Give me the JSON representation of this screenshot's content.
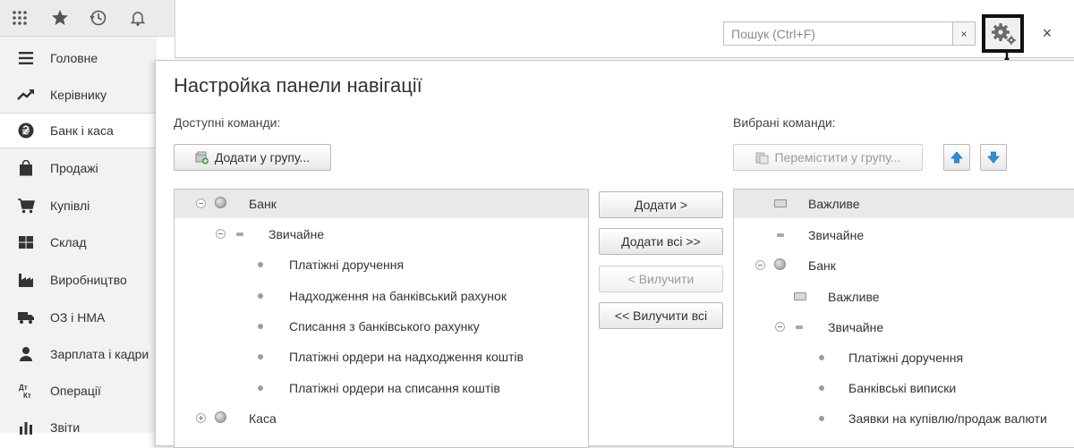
{
  "topbar": {
    "icons": [
      "apps-grid-icon",
      "star-icon",
      "history-icon",
      "bell-icon"
    ]
  },
  "sidebar": {
    "items": [
      {
        "label": "Головне",
        "icon": "menu-lines-icon"
      },
      {
        "label": "Керівнику",
        "icon": "trend-icon"
      },
      {
        "label": "Банк і каса",
        "icon": "hryvnia-coin-icon",
        "active": true
      },
      {
        "label": "Продажі",
        "icon": "shopping-bag-icon"
      },
      {
        "label": "Купівлі",
        "icon": "cart-icon"
      },
      {
        "label": "Склад",
        "icon": "warehouse-icon"
      },
      {
        "label": "Виробництво",
        "icon": "factory-icon"
      },
      {
        "label": "ОЗ і НМА",
        "icon": "truck-icon"
      },
      {
        "label": "Зарплата і кадри",
        "icon": "person-icon"
      },
      {
        "label": "Операції",
        "icon": "dt-kt-icon"
      },
      {
        "label": "Звіти",
        "icon": "bar-chart-icon"
      }
    ]
  },
  "search": {
    "placeholder": "Пошук (Ctrl+F)",
    "clear": "×"
  },
  "window": {
    "close": "×"
  },
  "dialog": {
    "title": "Настройка панели навігації",
    "available_label": "Доступні команди:",
    "selected_label": "Вибрані команди:",
    "add_to_group": "Додати у групу...",
    "move_to_group": "Перемістити у групу...",
    "add": "Додати >",
    "add_all": "Додати всі >>",
    "remove": "< Вилучити",
    "remove_all": "<< Вилучити всі",
    "available_tree": [
      {
        "text": "Банк",
        "kind": "group",
        "level": 0,
        "selected": true
      },
      {
        "text": "Звичайне",
        "kind": "section",
        "level": 1
      },
      {
        "text": "Платіжні доручення",
        "kind": "item",
        "level": 2
      },
      {
        "text": "Надходження на банківський рахунок",
        "kind": "item",
        "level": 2
      },
      {
        "text": "Списання з банківського рахунку",
        "kind": "item",
        "level": 2
      },
      {
        "text": "Платіжні ордери на надходження коштів",
        "kind": "item",
        "level": 2
      },
      {
        "text": "Платіжні ордери на списання коштів",
        "kind": "item",
        "level": 2
      },
      {
        "text": "Каса",
        "kind": "group-collapsed",
        "level": 0
      }
    ],
    "selected_tree": [
      {
        "text": "Важливе",
        "kind": "important",
        "level": 0,
        "selected": true
      },
      {
        "text": "Звичайне",
        "kind": "section",
        "level": 0
      },
      {
        "text": "Банк",
        "kind": "group",
        "level": 0
      },
      {
        "text": "Важливе",
        "kind": "important",
        "level": 1
      },
      {
        "text": "Звичайне",
        "kind": "section",
        "level": 1
      },
      {
        "text": "Платіжні доручення",
        "kind": "item",
        "level": 2
      },
      {
        "text": "Банківські виписки",
        "kind": "item",
        "level": 2
      },
      {
        "text": "Заявки на купівлю/продаж валюти",
        "kind": "item",
        "level": 2
      }
    ]
  },
  "colors": {
    "sidebar_bg": "#f2f2f2",
    "selected_row": "#e9e9e9",
    "arrow_blue": "#2f8fd8"
  }
}
